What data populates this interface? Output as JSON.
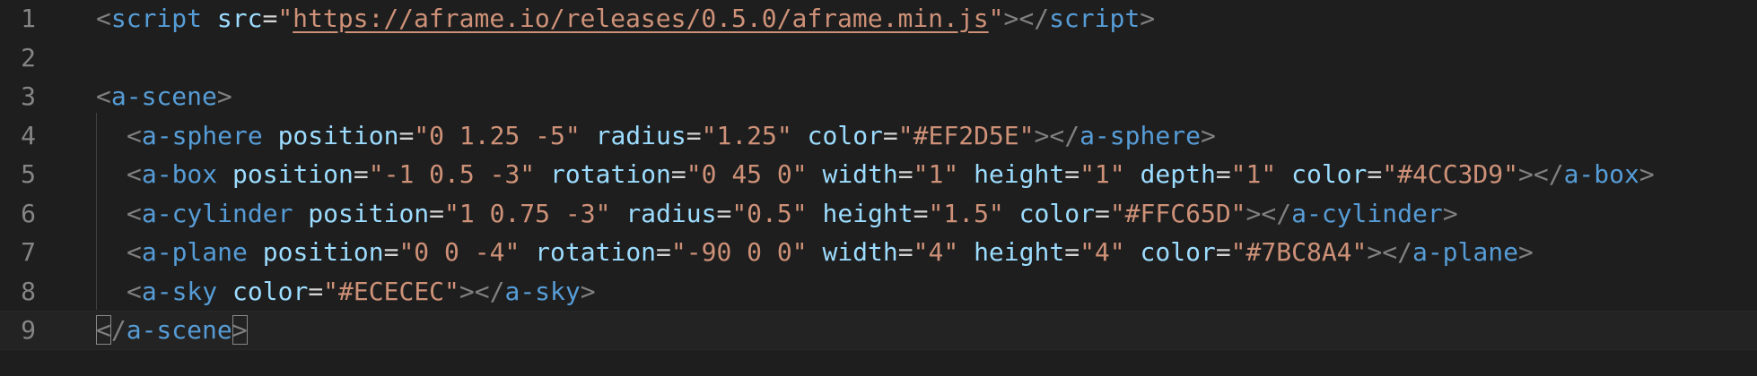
{
  "editor": {
    "lines": [
      {
        "number": "1",
        "indent": 0,
        "tokens": [
          {
            "t": "<",
            "c": "p"
          },
          {
            "t": "script",
            "c": "t"
          },
          {
            "t": " ",
            "c": "o"
          },
          {
            "t": "src",
            "c": "a"
          },
          {
            "t": "=",
            "c": "o"
          },
          {
            "t": "\"",
            "c": "s"
          },
          {
            "t": "https://aframe.io/releases/0.5.0/aframe.min.js",
            "c": "su"
          },
          {
            "t": "\"",
            "c": "s"
          },
          {
            "t": "></",
            "c": "p"
          },
          {
            "t": "script",
            "c": "t"
          },
          {
            "t": ">",
            "c": "p"
          }
        ]
      },
      {
        "number": "2",
        "indent": 0,
        "tokens": []
      },
      {
        "number": "3",
        "indent": 0,
        "tokens": [
          {
            "t": "<",
            "c": "p"
          },
          {
            "t": "a-scene",
            "c": "t"
          },
          {
            "t": ">",
            "c": "p"
          }
        ]
      },
      {
        "number": "4",
        "indent": 1,
        "tokens": [
          {
            "t": "<",
            "c": "p"
          },
          {
            "t": "a-sphere",
            "c": "t"
          },
          {
            "t": " ",
            "c": "o"
          },
          {
            "t": "position",
            "c": "a"
          },
          {
            "t": "=",
            "c": "o"
          },
          {
            "t": "\"0 1.25 -5\"",
            "c": "s"
          },
          {
            "t": " ",
            "c": "o"
          },
          {
            "t": "radius",
            "c": "a"
          },
          {
            "t": "=",
            "c": "o"
          },
          {
            "t": "\"1.25\"",
            "c": "s"
          },
          {
            "t": " ",
            "c": "o"
          },
          {
            "t": "color",
            "c": "a"
          },
          {
            "t": "=",
            "c": "o"
          },
          {
            "t": "\"#EF2D5E\"",
            "c": "s"
          },
          {
            "t": "></",
            "c": "p"
          },
          {
            "t": "a-sphere",
            "c": "t"
          },
          {
            "t": ">",
            "c": "p"
          }
        ]
      },
      {
        "number": "5",
        "indent": 1,
        "tokens": [
          {
            "t": "<",
            "c": "p"
          },
          {
            "t": "a-box",
            "c": "t"
          },
          {
            "t": " ",
            "c": "o"
          },
          {
            "t": "position",
            "c": "a"
          },
          {
            "t": "=",
            "c": "o"
          },
          {
            "t": "\"-1 0.5 -3\"",
            "c": "s"
          },
          {
            "t": " ",
            "c": "o"
          },
          {
            "t": "rotation",
            "c": "a"
          },
          {
            "t": "=",
            "c": "o"
          },
          {
            "t": "\"0 45 0\"",
            "c": "s"
          },
          {
            "t": " ",
            "c": "o"
          },
          {
            "t": "width",
            "c": "a"
          },
          {
            "t": "=",
            "c": "o"
          },
          {
            "t": "\"1\"",
            "c": "s"
          },
          {
            "t": " ",
            "c": "o"
          },
          {
            "t": "height",
            "c": "a"
          },
          {
            "t": "=",
            "c": "o"
          },
          {
            "t": "\"1\"",
            "c": "s"
          },
          {
            "t": " ",
            "c": "o"
          },
          {
            "t": "depth",
            "c": "a"
          },
          {
            "t": "=",
            "c": "o"
          },
          {
            "t": "\"1\"",
            "c": "s"
          },
          {
            "t": " ",
            "c": "o"
          },
          {
            "t": "color",
            "c": "a"
          },
          {
            "t": "=",
            "c": "o"
          },
          {
            "t": "\"#4CC3D9\"",
            "c": "s"
          },
          {
            "t": "></",
            "c": "p"
          },
          {
            "t": "a-box",
            "c": "t"
          },
          {
            "t": ">",
            "c": "p"
          }
        ]
      },
      {
        "number": "6",
        "indent": 1,
        "tokens": [
          {
            "t": "<",
            "c": "p"
          },
          {
            "t": "a-cylinder",
            "c": "t"
          },
          {
            "t": " ",
            "c": "o"
          },
          {
            "t": "position",
            "c": "a"
          },
          {
            "t": "=",
            "c": "o"
          },
          {
            "t": "\"1 0.75 -3\"",
            "c": "s"
          },
          {
            "t": " ",
            "c": "o"
          },
          {
            "t": "radius",
            "c": "a"
          },
          {
            "t": "=",
            "c": "o"
          },
          {
            "t": "\"0.5\"",
            "c": "s"
          },
          {
            "t": " ",
            "c": "o"
          },
          {
            "t": "height",
            "c": "a"
          },
          {
            "t": "=",
            "c": "o"
          },
          {
            "t": "\"1.5\"",
            "c": "s"
          },
          {
            "t": " ",
            "c": "o"
          },
          {
            "t": "color",
            "c": "a"
          },
          {
            "t": "=",
            "c": "o"
          },
          {
            "t": "\"#FFC65D\"",
            "c": "s"
          },
          {
            "t": "></",
            "c": "p"
          },
          {
            "t": "a-cylinder",
            "c": "t"
          },
          {
            "t": ">",
            "c": "p"
          }
        ]
      },
      {
        "number": "7",
        "indent": 1,
        "tokens": [
          {
            "t": "<",
            "c": "p"
          },
          {
            "t": "a-plane",
            "c": "t"
          },
          {
            "t": " ",
            "c": "o"
          },
          {
            "t": "position",
            "c": "a"
          },
          {
            "t": "=",
            "c": "o"
          },
          {
            "t": "\"0 0 -4\"",
            "c": "s"
          },
          {
            "t": " ",
            "c": "o"
          },
          {
            "t": "rotation",
            "c": "a"
          },
          {
            "t": "=",
            "c": "o"
          },
          {
            "t": "\"-90 0 0\"",
            "c": "s"
          },
          {
            "t": " ",
            "c": "o"
          },
          {
            "t": "width",
            "c": "a"
          },
          {
            "t": "=",
            "c": "o"
          },
          {
            "t": "\"4\"",
            "c": "s"
          },
          {
            "t": " ",
            "c": "o"
          },
          {
            "t": "height",
            "c": "a"
          },
          {
            "t": "=",
            "c": "o"
          },
          {
            "t": "\"4\"",
            "c": "s"
          },
          {
            "t": " ",
            "c": "o"
          },
          {
            "t": "color",
            "c": "a"
          },
          {
            "t": "=",
            "c": "o"
          },
          {
            "t": "\"#7BC8A4\"",
            "c": "s"
          },
          {
            "t": "></",
            "c": "p"
          },
          {
            "t": "a-plane",
            "c": "t"
          },
          {
            "t": ">",
            "c": "p"
          }
        ]
      },
      {
        "number": "8",
        "indent": 1,
        "tokens": [
          {
            "t": "<",
            "c": "p"
          },
          {
            "t": "a-sky",
            "c": "t"
          },
          {
            "t": " ",
            "c": "o"
          },
          {
            "t": "color",
            "c": "a"
          },
          {
            "t": "=",
            "c": "o"
          },
          {
            "t": "\"#ECECEC\"",
            "c": "s"
          },
          {
            "t": "></",
            "c": "p"
          },
          {
            "t": "a-sky",
            "c": "t"
          },
          {
            "t": ">",
            "c": "p"
          }
        ]
      },
      {
        "number": "9",
        "indent": 0,
        "current": true,
        "tokens": [
          {
            "t": "<",
            "c": "p",
            "bracket_match": true
          },
          {
            "t": "/",
            "c": "p"
          },
          {
            "t": "a-scene",
            "c": "t"
          },
          {
            "t": ">",
            "c": "p",
            "bracket_match": true
          }
        ]
      }
    ]
  },
  "theme": {
    "background": "#1e1e1e",
    "line_number": "#858585",
    "punctuation": "#808080",
    "tag": "#569cd6",
    "attribute": "#9cdcfe",
    "string": "#ce9178"
  }
}
